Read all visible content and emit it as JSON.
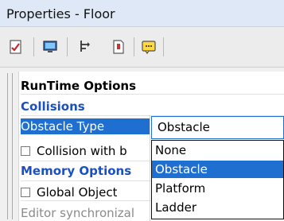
{
  "window": {
    "title": "Properties - Floor"
  },
  "toolbar": {
    "icons": [
      "check-document-icon",
      "monitor-icon",
      "network-icon",
      "red-document-icon",
      "yellow-speech-icon"
    ]
  },
  "properties": {
    "runtime_options_label": "RunTime Options",
    "collisions_label": "Collisions",
    "obstacle_type_label": "Obstacle Type",
    "collision_with_label": "Collision with b",
    "memory_options_label": "Memory Options",
    "global_object_label": "Global Object",
    "editor_sync_label": "Editor synchronizal"
  },
  "combo": {
    "selected_value": "Obstacle"
  },
  "dropdown": {
    "options": [
      "None",
      "Obstacle",
      "Platform",
      "Ladder"
    ],
    "active_option": "Obstacle"
  },
  "colors": {
    "selection": "#1f6fd0",
    "section_text": "#1c4fbf"
  }
}
